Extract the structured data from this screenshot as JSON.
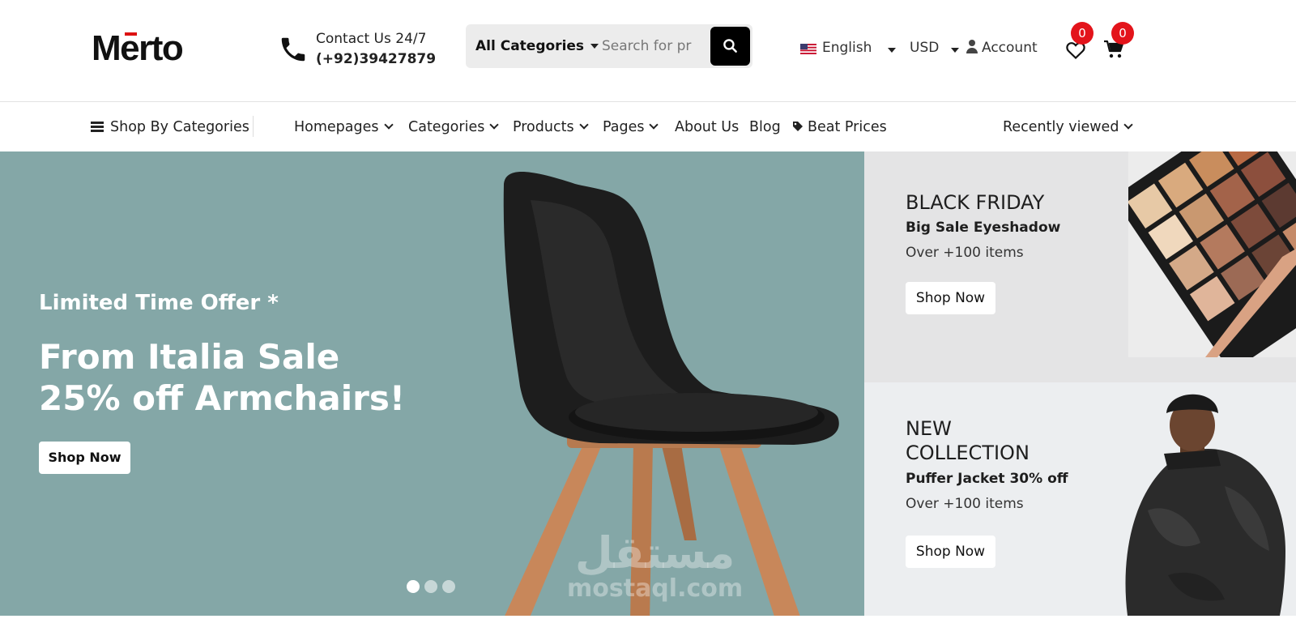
{
  "brand": {
    "logo_text": "Merto",
    "accent": "#e3141b"
  },
  "contact": {
    "label": "Contact Us 24/7",
    "phone": "(+92)39427879"
  },
  "search": {
    "category": "All Categories",
    "placeholder": "Search for products",
    "value": "Search for pr"
  },
  "header": {
    "language": "English",
    "currency": "USD",
    "account": "Account",
    "wishlist_count": "0",
    "cart_count": "0"
  },
  "nav": {
    "shop_by": "Shop By Categories",
    "items": [
      {
        "label": "Homepages",
        "dropdown": true
      },
      {
        "label": "Categories",
        "dropdown": true
      },
      {
        "label": "Products",
        "dropdown": true
      },
      {
        "label": "Pages",
        "dropdown": true
      },
      {
        "label": "About Us",
        "dropdown": false
      },
      {
        "label": "Blog",
        "dropdown": false
      },
      {
        "label": "Beat Prices",
        "dropdown": false
      }
    ],
    "recent": "Recently viewed"
  },
  "hero": {
    "kicker": "Limited Time Offer *",
    "title": "From Italia Sale 25% off Armchairs!",
    "button": "Shop Now",
    "slides": 3,
    "active_slide": 1,
    "bg": "#84a7a7"
  },
  "promos": [
    {
      "title": "BLACK FRIDAY",
      "subtitle": "Big Sale Eyeshadow",
      "meta": "Over +100 items",
      "button": "Shop Now"
    },
    {
      "title": "NEW COLLECTION",
      "subtitle": "Puffer Jacket 30% off",
      "meta": "Over +100 items",
      "button": "Shop Now"
    }
  ],
  "watermark": {
    "arabic": "مستقل",
    "latin": "mostaql.com"
  }
}
